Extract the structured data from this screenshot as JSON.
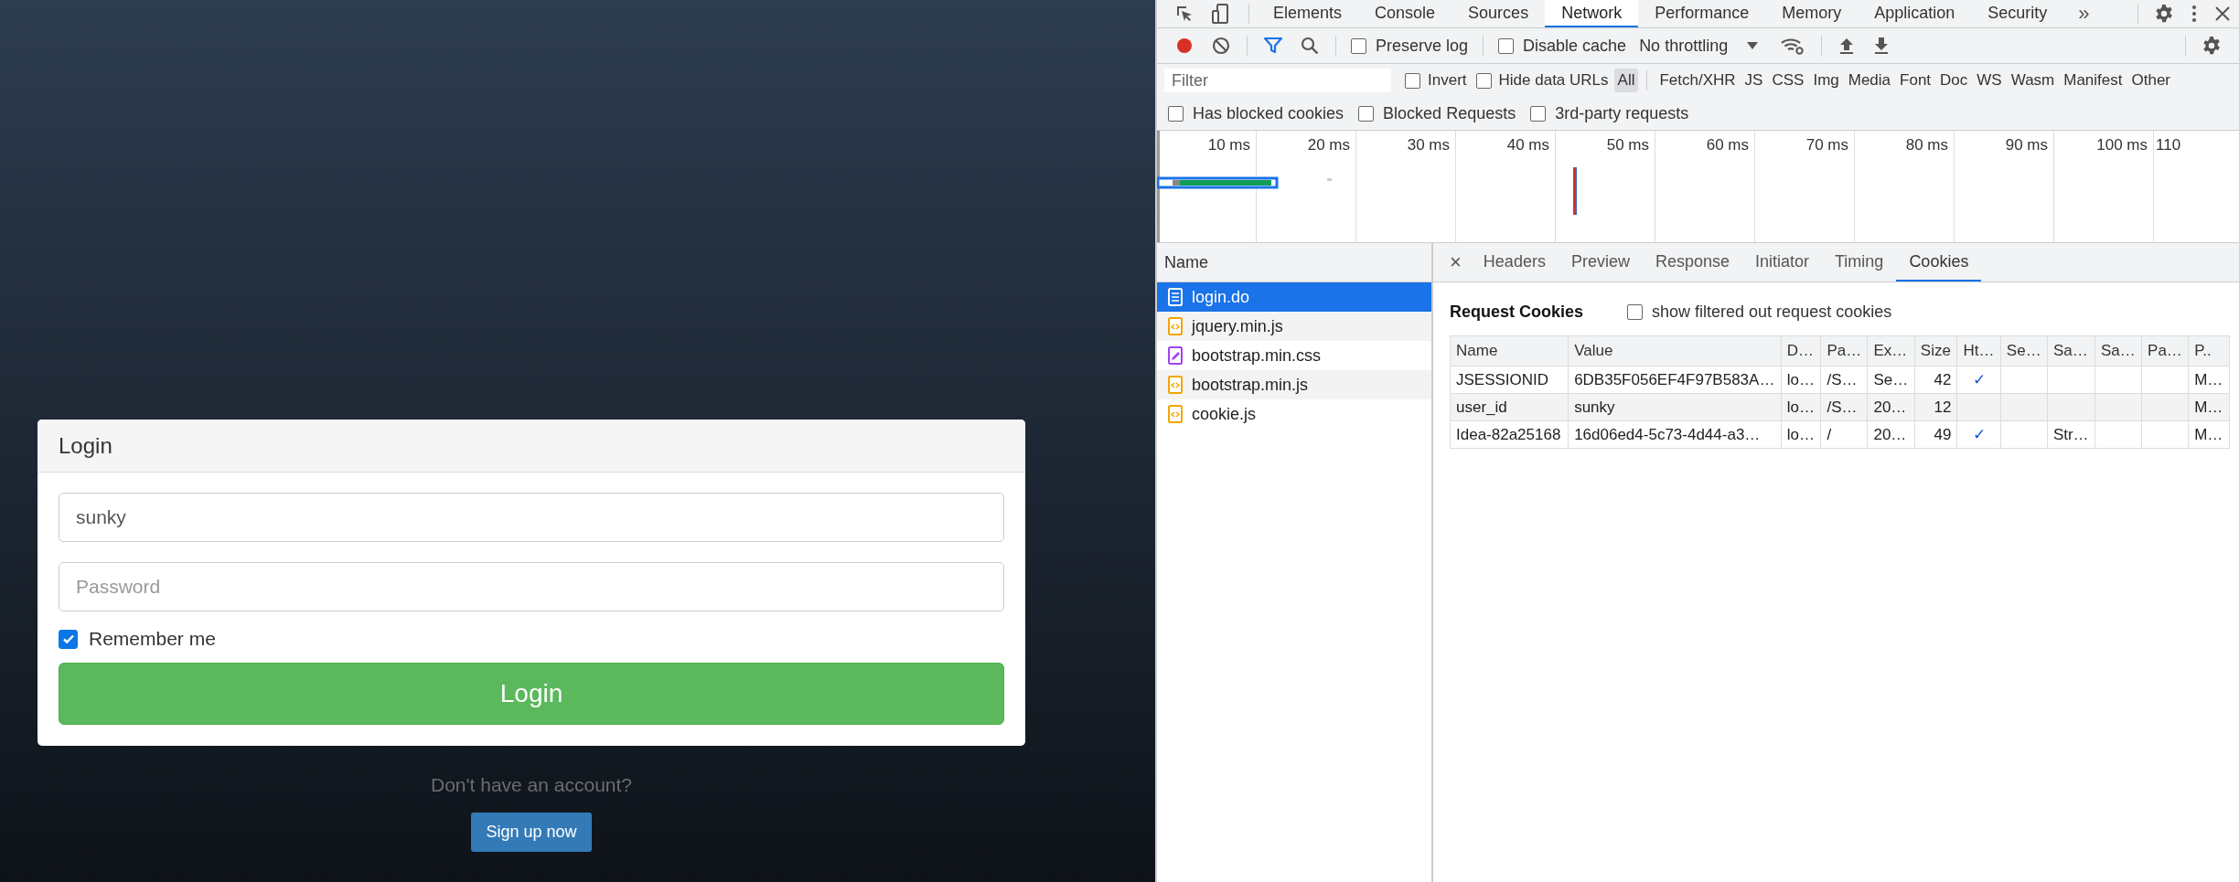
{
  "login_card": {
    "title": "Login",
    "username": {
      "value": "sunky"
    },
    "password": {
      "placeholder": "Password"
    },
    "remember": {
      "label": "Remember me",
      "checked": true
    },
    "submit": "Login"
  },
  "signup": {
    "prompt": "Don't have an account?",
    "button": "Sign up now"
  },
  "devtools": {
    "tabs": [
      {
        "label": "Elements",
        "selected": false
      },
      {
        "label": "Console",
        "selected": false
      },
      {
        "label": "Sources",
        "selected": false
      },
      {
        "label": "Network",
        "selected": true
      },
      {
        "label": "Performance",
        "selected": false
      },
      {
        "label": "Memory",
        "selected": false
      },
      {
        "label": "Application",
        "selected": false
      },
      {
        "label": "Security",
        "selected": false
      }
    ],
    "more_tabs": "»",
    "toolbar": {
      "preserve_log": {
        "label": "Preserve log",
        "checked": false
      },
      "disable_cache": {
        "label": "Disable cache",
        "checked": false
      },
      "throttling": "No throttling"
    },
    "filter": {
      "placeholder": "Filter",
      "invert": {
        "label": "Invert",
        "checked": false
      },
      "hide_data_urls": {
        "label": "Hide data URLs",
        "checked": false
      },
      "types": [
        {
          "label": "All",
          "selected": true
        },
        {
          "label": "Fetch/XHR",
          "selected": false
        },
        {
          "label": "JS",
          "selected": false
        },
        {
          "label": "CSS",
          "selected": false
        },
        {
          "label": "Img",
          "selected": false
        },
        {
          "label": "Media",
          "selected": false
        },
        {
          "label": "Font",
          "selected": false
        },
        {
          "label": "Doc",
          "selected": false
        },
        {
          "label": "WS",
          "selected": false
        },
        {
          "label": "Wasm",
          "selected": false
        },
        {
          "label": "Manifest",
          "selected": false
        },
        {
          "label": "Other",
          "selected": false
        }
      ]
    },
    "blocked_filters": [
      {
        "label": "Has blocked cookies",
        "checked": false
      },
      {
        "label": "Blocked Requests",
        "checked": false
      },
      {
        "label": "3rd-party requests",
        "checked": false
      }
    ],
    "timeline": {
      "ticks": [
        "10 ms",
        "20 ms",
        "30 ms",
        "40 ms",
        "50 ms",
        "60 ms",
        "70 ms",
        "80 ms",
        "90 ms",
        "100 ms",
        "110"
      ]
    },
    "requests": {
      "header": "Name",
      "items": [
        {
          "name": "login.do",
          "kind": "document",
          "selected": true
        },
        {
          "name": "jquery.min.js",
          "kind": "script",
          "selected": false
        },
        {
          "name": "bootstrap.min.css",
          "kind": "stylesheet",
          "selected": false
        },
        {
          "name": "bootstrap.min.js",
          "kind": "script",
          "selected": false
        },
        {
          "name": "cookie.js",
          "kind": "script",
          "selected": false
        }
      ]
    },
    "detail": {
      "close": "×",
      "tabs": [
        {
          "label": "Headers",
          "selected": false
        },
        {
          "label": "Preview",
          "selected": false
        },
        {
          "label": "Response",
          "selected": false
        },
        {
          "label": "Initiator",
          "selected": false
        },
        {
          "label": "Timing",
          "selected": false
        },
        {
          "label": "Cookies",
          "selected": true
        }
      ],
      "section_title": "Request Cookies",
      "show_filtered": {
        "label": "show filtered out request cookies",
        "checked": false
      },
      "columns": [
        "Name",
        "Value",
        "D…",
        "Pa…",
        "Ex…",
        "Size",
        "Ht…",
        "Se…",
        "Sa…",
        "Sa…",
        "Pa…",
        "P.."
      ],
      "rows": [
        [
          "JSESSIONID",
          "6DB35F056EF4F97B583A…",
          "lo…",
          "/S…",
          "Se…",
          "42",
          "✓",
          "",
          "",
          "",
          "",
          "M…"
        ],
        [
          "user_id",
          "sunky",
          "lo…",
          "/S…",
          "20…",
          "12",
          "",
          "",
          "",
          "",
          "",
          "M…"
        ],
        [
          "Idea-82a25168",
          "16d06ed4-5c73-4d44-a3…",
          "lo…",
          "/",
          "20…",
          "49",
          "✓",
          "",
          "Str…",
          "",
          "",
          "M…"
        ]
      ]
    }
  }
}
